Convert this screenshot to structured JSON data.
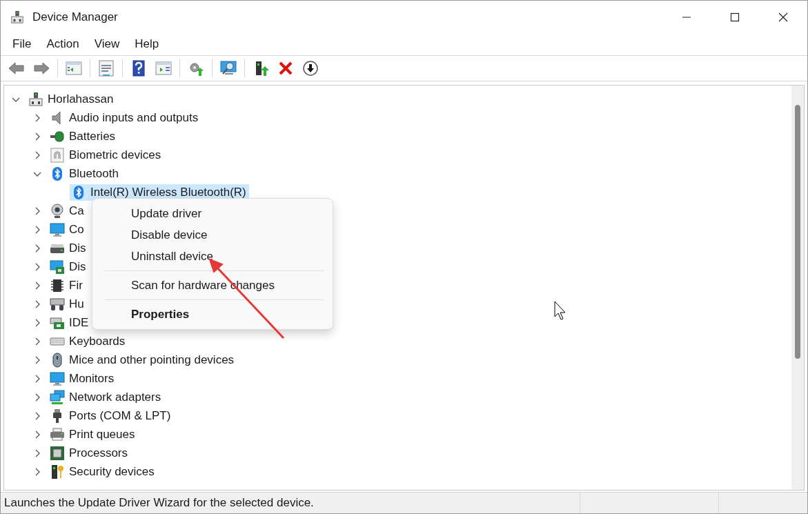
{
  "window": {
    "title": "Device Manager"
  },
  "menu_bar": [
    "File",
    "Action",
    "View",
    "Help"
  ],
  "toolbar": [
    {
      "kind": "back"
    },
    {
      "kind": "forward"
    },
    {
      "kind": "separator"
    },
    {
      "kind": "tree"
    },
    {
      "kind": "separator"
    },
    {
      "kind": "properties"
    },
    {
      "kind": "separator"
    },
    {
      "kind": "help"
    },
    {
      "kind": "pane"
    },
    {
      "kind": "separator"
    },
    {
      "kind": "update"
    },
    {
      "kind": "separator"
    },
    {
      "kind": "scan"
    },
    {
      "kind": "separator"
    },
    {
      "kind": "enable"
    },
    {
      "kind": "uninstall"
    },
    {
      "kind": "disable"
    }
  ],
  "tree": {
    "label": "Horlahassan",
    "kind": "computer",
    "expanded": true,
    "selected": false,
    "children": [
      {
        "label": "Audio inputs and outputs",
        "kind": "speaker",
        "expanded": false,
        "selected": false
      },
      {
        "label": "Batteries",
        "kind": "battery",
        "expanded": false,
        "selected": false
      },
      {
        "label": "Biometric devices",
        "kind": "fingerprint",
        "expanded": false,
        "selected": false
      },
      {
        "label": "Bluetooth",
        "kind": "bluetooth",
        "expanded": true,
        "selected": false,
        "children": [
          {
            "label": "Intel(R) Wireless Bluetooth(R)",
            "kind": "bluetooth",
            "selected": true
          }
        ]
      },
      {
        "label": "Ca",
        "kind": "camera",
        "expanded": false,
        "selected": false
      },
      {
        "label": "Co",
        "kind": "monitor",
        "expanded": false,
        "selected": false
      },
      {
        "label": "Dis",
        "kind": "disk",
        "expanded": false,
        "selected": false
      },
      {
        "label": "Dis",
        "kind": "display",
        "expanded": false,
        "selected": false
      },
      {
        "label": "Fir",
        "kind": "chip",
        "expanded": false,
        "selected": false
      },
      {
        "label": "Hu",
        "kind": "hid",
        "expanded": false,
        "selected": false
      },
      {
        "label": "IDE",
        "kind": "controller",
        "expanded": false,
        "selected": false
      },
      {
        "label": "Keyboards",
        "kind": "keyboard",
        "expanded": false,
        "selected": false
      },
      {
        "label": "Mice and other pointing devices",
        "kind": "mouse",
        "expanded": false,
        "selected": false
      },
      {
        "label": "Monitors",
        "kind": "monitor",
        "expanded": false,
        "selected": false
      },
      {
        "label": "Network adapters",
        "kind": "network",
        "expanded": false,
        "selected": false
      },
      {
        "label": "Ports (COM & LPT)",
        "kind": "port",
        "expanded": false,
        "selected": false
      },
      {
        "label": "Print queues",
        "kind": "printer",
        "expanded": false,
        "selected": false
      },
      {
        "label": "Processors",
        "kind": "processor",
        "expanded": false,
        "selected": false
      },
      {
        "label": "Security devices",
        "kind": "security",
        "expanded": false,
        "selected": false
      }
    ]
  },
  "context_menu": [
    {
      "kind": "item",
      "label": "Update driver",
      "default": false
    },
    {
      "kind": "item",
      "label": "Disable device",
      "default": false
    },
    {
      "kind": "item",
      "label": "Uninstall device",
      "default": false
    },
    {
      "kind": "separator"
    },
    {
      "kind": "item",
      "label": "Scan for hardware changes",
      "default": false
    },
    {
      "kind": "separator"
    },
    {
      "kind": "item",
      "label": "Properties",
      "default": true
    }
  ],
  "status_bar": {
    "text": "Launches the Update Driver Wizard for the selected device."
  }
}
